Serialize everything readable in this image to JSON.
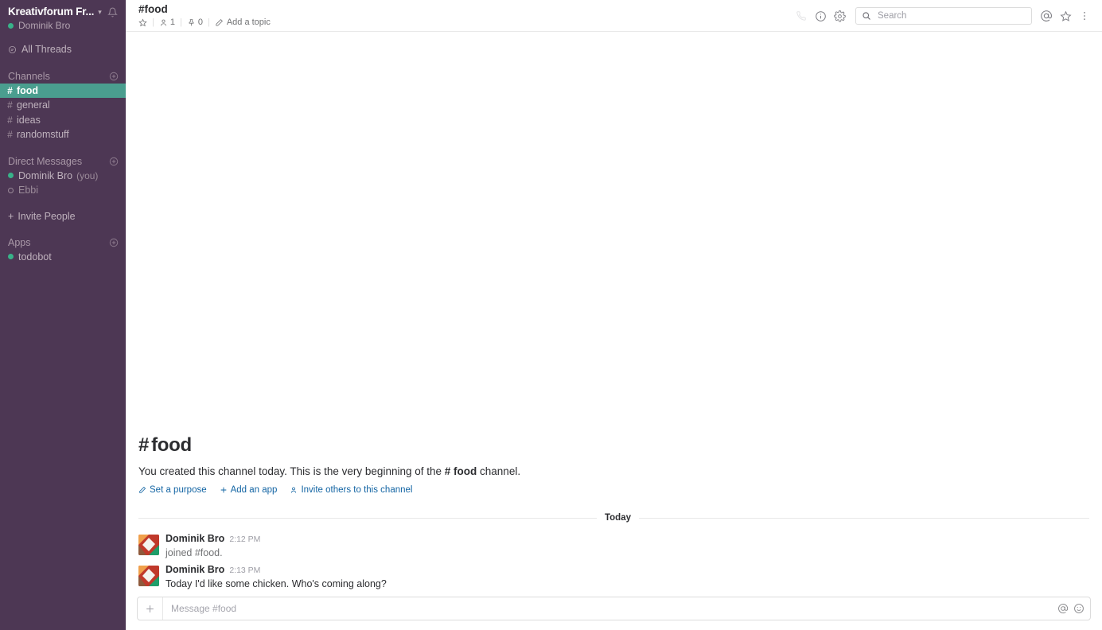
{
  "sidebar": {
    "workspace": {
      "name": "Kreativforum Fr...",
      "caret_icon": "chevron-down-icon",
      "bell_icon": "bell-icon",
      "user_name": "Dominik Bro",
      "user_presence": "online"
    },
    "all_threads": {
      "label": "All Threads",
      "icon": "threads-icon"
    },
    "channels_section": {
      "label": "Channels",
      "add_icon": "plus-circle-icon"
    },
    "channels": [
      {
        "name": "food",
        "active": true
      },
      {
        "name": "general",
        "active": false
      },
      {
        "name": "ideas",
        "active": false
      },
      {
        "name": "randomstuff",
        "active": false
      }
    ],
    "dm_section": {
      "label": "Direct Messages",
      "add_icon": "plus-circle-icon"
    },
    "dms": [
      {
        "name": "Dominik Bro",
        "suffix": "(you)",
        "presence": "online"
      },
      {
        "name": "Ebbi",
        "suffix": "",
        "presence": "offline"
      }
    ],
    "invite_people": {
      "label": "Invite People",
      "icon": "plus-icon"
    },
    "apps_section": {
      "label": "Apps",
      "add_icon": "plus-circle-icon"
    },
    "apps": [
      {
        "name": "todobot",
        "presence": "online"
      }
    ]
  },
  "header": {
    "channel_title": "#food",
    "star_icon": "star-icon",
    "members_icon": "person-icon",
    "members_count": "1",
    "pins_icon": "pin-icon",
    "pins_count": "0",
    "topic_icon": "pencil-icon",
    "topic_label": "Add a topic",
    "call_icon": "phone-icon",
    "info_icon": "info-circle-icon",
    "settings_icon": "gear-icon",
    "mentions_icon": "at-icon",
    "starred_icon": "star-icon",
    "more_icon": "kebab-menu-icon",
    "search": {
      "icon": "search-icon",
      "placeholder": "Search",
      "value": ""
    }
  },
  "intro": {
    "hash": "#",
    "channel_name": "food",
    "text_before": "You created this channel today. This is the very beginning of the",
    "channel_ref": "# food",
    "text_after": "channel.",
    "actions": [
      {
        "label": "Set a purpose",
        "icon": "pencil-icon"
      },
      {
        "label": "Add an app",
        "icon": "plus-icon"
      },
      {
        "label": "Invite others to this channel",
        "icon": "person-icon"
      }
    ]
  },
  "conversation": {
    "day_divider": "Today",
    "messages": [
      {
        "author": "Dominik Bro",
        "time": "2:12 PM",
        "text": "joined #food.",
        "system": true,
        "avatar": "pinwheel-avatar"
      },
      {
        "author": "Dominik Bro",
        "time": "2:13 PM",
        "text": "Today I'd like some chicken. Who's coming along?",
        "system": false,
        "avatar": "pinwheel-avatar"
      }
    ]
  },
  "composer": {
    "add_icon": "plus-icon",
    "placeholder": "Message #food",
    "value": "",
    "mention_icon": "at-icon",
    "emoji_icon": "smiley-icon"
  },
  "colors": {
    "sidebar_bg": "#4d3754",
    "active_channel_bg": "#4a9e8f",
    "presence_online": "#38b289",
    "link": "#1264a3",
    "text_primary": "#2c2d30",
    "text_muted": "#717274"
  }
}
